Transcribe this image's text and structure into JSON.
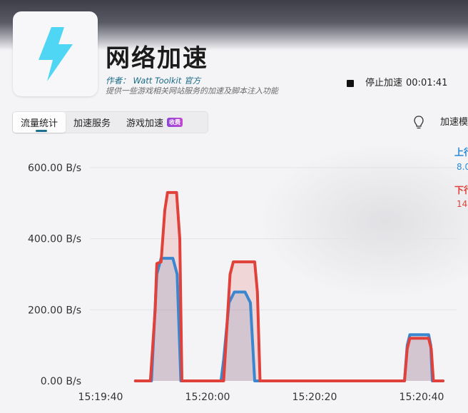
{
  "app": {
    "title": "网络加速",
    "author_prefix": "作者：",
    "author_name": "Watt Toolkit",
    "author_suffix": "官方",
    "description": "提供一些游戏相关网站服务的加速及脚本注入功能",
    "icon": "lightning-bolt-icon",
    "accent_color": "#4fd6f5"
  },
  "controls": {
    "stop_label": "停止加速",
    "elapsed": "00:01:41",
    "mode_label": "加速模",
    "mode_icon": "lightbulb-icon"
  },
  "tabs": [
    {
      "label": "流量统计",
      "active": true
    },
    {
      "label": "加速服务",
      "active": false
    },
    {
      "label": "游戏加速",
      "active": false,
      "badge": "收费"
    }
  ],
  "legend": {
    "upload_label": "上行",
    "upload_value": "8.0",
    "download_label": "下行",
    "download_value": "14."
  },
  "chart_data": {
    "type": "area",
    "ytick_labels": [
      "0.00 B/s",
      "200.00 B/s",
      "400.00 B/s",
      "600.00 B/s"
    ],
    "xtick_labels": [
      "15:19:40",
      "15:20:00",
      "15:20:20",
      "15:20:40"
    ],
    "ylim": [
      0,
      600
    ],
    "x_units": "seconds after 15:19:40",
    "series": [
      {
        "name": "上行",
        "color": "#3a86cf",
        "points": [
          [
            6.5,
            0
          ],
          [
            8.3,
            0
          ],
          [
            9.5,
            0
          ],
          [
            10.5,
            300
          ],
          [
            11.3,
            345
          ],
          [
            13.5,
            345
          ],
          [
            14.3,
            300
          ],
          [
            15,
            0
          ],
          [
            17,
            0
          ],
          [
            22.5,
            0
          ],
          [
            23,
            60
          ],
          [
            24,
            220
          ],
          [
            25,
            250
          ],
          [
            27,
            250
          ],
          [
            28,
            220
          ],
          [
            28.8,
            0
          ],
          [
            30,
            0
          ],
          [
            52,
            0
          ],
          [
            56.8,
            0
          ],
          [
            57.3,
            100
          ],
          [
            57.8,
            130
          ],
          [
            61.3,
            130
          ],
          [
            61.7,
            100
          ],
          [
            62,
            0
          ],
          [
            64,
            0
          ]
        ]
      },
      {
        "name": "下行",
        "color": "#e0413a",
        "points": [
          [
            6.5,
            0
          ],
          [
            9.3,
            0
          ],
          [
            10.2,
            200
          ],
          [
            10.5,
            330
          ],
          [
            11.3,
            335
          ],
          [
            12,
            480
          ],
          [
            12.5,
            530
          ],
          [
            14.2,
            530
          ],
          [
            14.8,
            400
          ],
          [
            15.2,
            0
          ],
          [
            17,
            0
          ],
          [
            23,
            0
          ],
          [
            24.2,
            300
          ],
          [
            24.8,
            335
          ],
          [
            28.8,
            335
          ],
          [
            29.3,
            250
          ],
          [
            29.8,
            0
          ],
          [
            31,
            0
          ],
          [
            52,
            0
          ],
          [
            56.8,
            0
          ],
          [
            57.3,
            90
          ],
          [
            57.8,
            120
          ],
          [
            61.3,
            120
          ],
          [
            61.8,
            90
          ],
          [
            62.2,
            0
          ],
          [
            64,
            0
          ]
        ]
      }
    ],
    "grid": true
  }
}
